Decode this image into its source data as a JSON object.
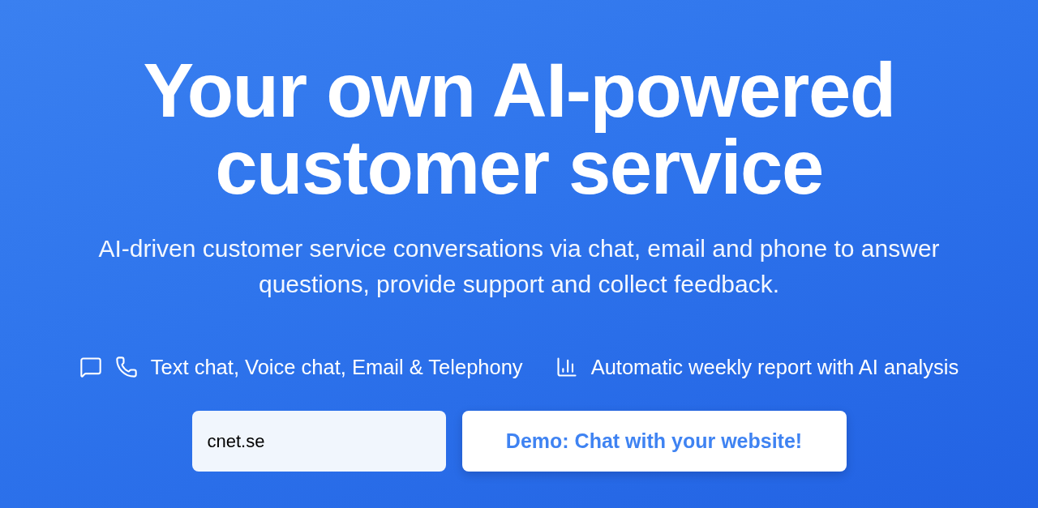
{
  "hero": {
    "headline": "Your own AI-powered customer service",
    "subtitle": "AI-driven customer service conversations via chat, email and phone to answer questions, provide support and collect feedback."
  },
  "features": [
    {
      "kind": "channels",
      "label": "Text chat, Voice chat, Email & Telephony"
    },
    {
      "kind": "report",
      "label": "Automatic weekly report with AI analysis"
    }
  ],
  "demo_form": {
    "domain_field": {
      "value": "cnet.se"
    },
    "submit_button": {
      "label": "Demo: Chat with your website!"
    }
  }
}
